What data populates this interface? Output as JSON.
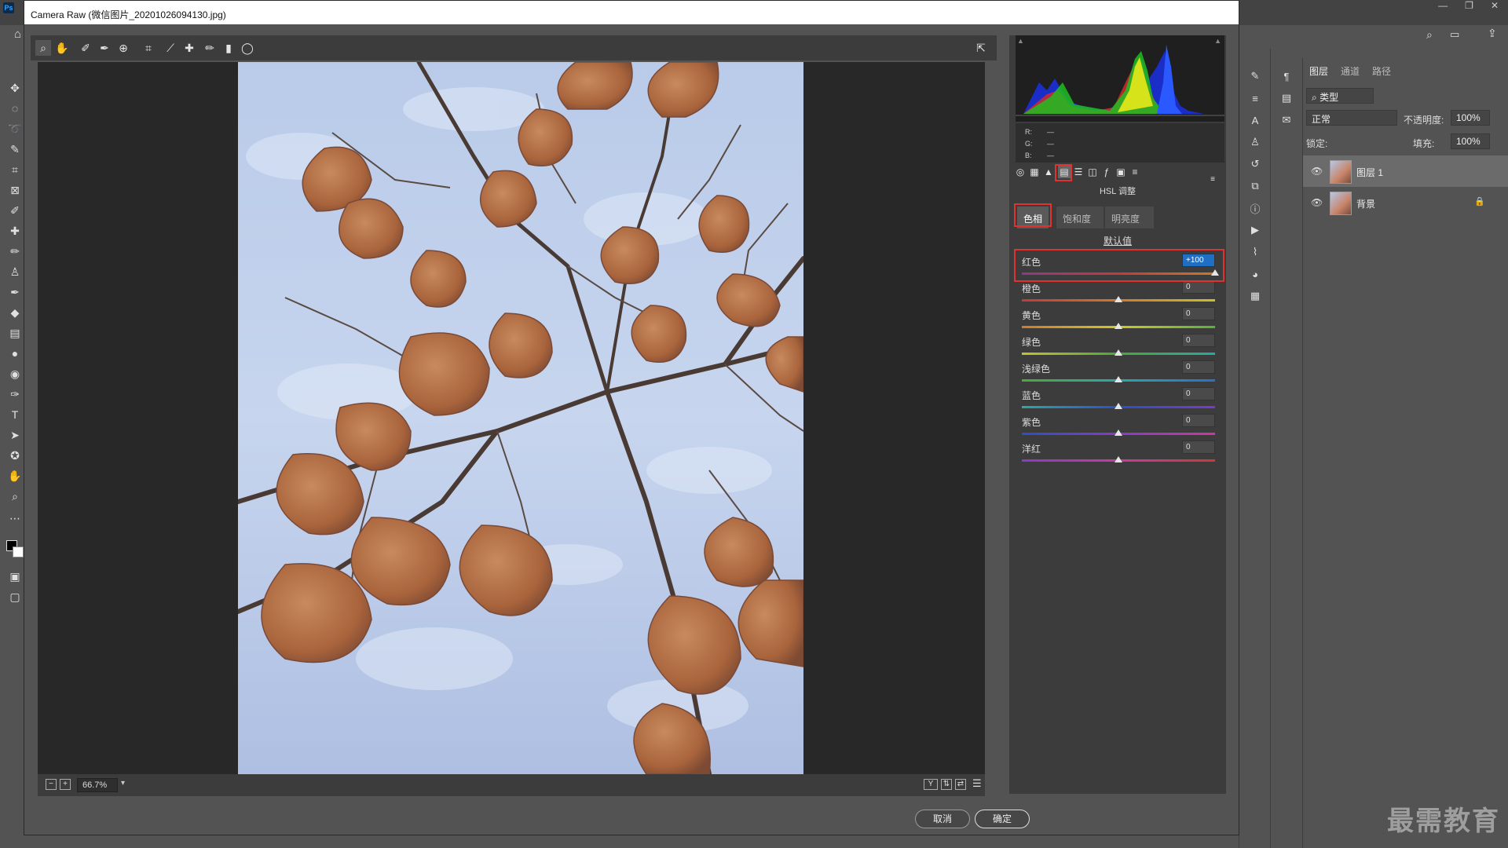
{
  "ps": {
    "logo": "Ps",
    "win_controls": [
      "—",
      "❐",
      "✕"
    ]
  },
  "layers_panel": {
    "tabs": [
      "图层",
      "通道",
      "路径"
    ],
    "filter_label": "类型",
    "blend_mode": "正常",
    "opacity_label": "不透明度:",
    "opacity_value": "100%",
    "lock_label": "锁定:",
    "fill_label": "填充:",
    "fill_value": "100%",
    "layers": [
      {
        "name": "图层 1",
        "selected": true
      },
      {
        "name": "背景",
        "selected": false,
        "locked": true
      }
    ]
  },
  "camera_raw": {
    "title": "Camera Raw (微信图片_20201026094130.jpg)",
    "zoom": "66.7%",
    "rgb": {
      "r_label": "R:",
      "g_label": "G:",
      "b_label": "B:",
      "r": "—",
      "g": "—",
      "b": "—"
    },
    "panel_title": "HSL 调整",
    "tabs": [
      "色相",
      "饱和度",
      "明亮度"
    ],
    "active_tab": "色相",
    "default_link": "默认值",
    "sliders": [
      {
        "label": "红色",
        "value": "+100",
        "level": 100,
        "editing": true,
        "track": "linear-gradient(90deg,#8a3a8a,#c63a3a 50%,#c77a2a)"
      },
      {
        "label": "橙色",
        "value": "0",
        "level": 0,
        "track": "linear-gradient(90deg,#c03b3b,#d07a2a 50%,#c8c02a)"
      },
      {
        "label": "黄色",
        "value": "0",
        "level": 0,
        "track": "linear-gradient(90deg,#d07a2a,#d0c82a 50%,#5ab03a)"
      },
      {
        "label": "绿色",
        "value": "0",
        "level": 0,
        "track": "linear-gradient(90deg,#c8c02a,#4aa83a 50%,#2aa8a0)"
      },
      {
        "label": "浅绿色",
        "value": "0",
        "level": 0,
        "track": "linear-gradient(90deg,#4aa83a,#2aa8a8 50%,#2a70c8)"
      },
      {
        "label": "蓝色",
        "value": "0",
        "level": 0,
        "track": "linear-gradient(90deg,#2aa8a8,#2a50c8 50%,#7a3ac8)"
      },
      {
        "label": "紫色",
        "value": "0",
        "level": 0,
        "track": "linear-gradient(90deg,#2a50c8,#8a3ac8 50%,#c83aa0)"
      },
      {
        "label": "洋红",
        "value": "0",
        "level": 0,
        "track": "linear-gradient(90deg,#8a3ac8,#c83aa0 50%,#c83a3a)"
      }
    ],
    "cancel_label": "取消",
    "ok_label": "确定"
  },
  "watermark": "最需教育",
  "colors": {
    "highlight": "#e0322f",
    "edit_blue": "#1f6fc5"
  }
}
